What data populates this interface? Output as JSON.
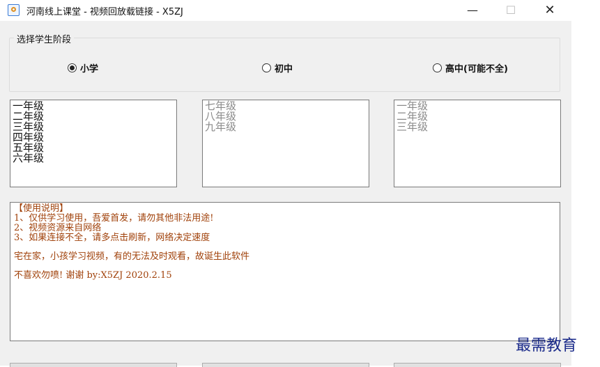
{
  "window": {
    "title": "河南线上课堂 - 视频回放载链接 - X5ZJ",
    "minimize": "—",
    "maximize": "☐",
    "close": "✕"
  },
  "stage_group": {
    "label": "选择学生阶段",
    "options": [
      {
        "label": "小学",
        "checked": true
      },
      {
        "label": "初中",
        "checked": false
      },
      {
        "label": "高中(可能不全)",
        "checked": false
      }
    ]
  },
  "grade_lists": {
    "primary": [
      "一年级",
      "二年级",
      "三年级",
      "四年级",
      "五年级",
      "六年级"
    ],
    "junior": [
      "七年级",
      "八年级",
      "九年级"
    ],
    "senior": [
      "一年级",
      "二年级",
      "三年级"
    ]
  },
  "notes": {
    "heading": "【使用说明】",
    "line1": "1、仅供学习使用，吾爱首发，请勿其他非法用途!",
    "line2": "2、视频资源来自网络",
    "line3": "3、如果连接不全，请多点击刷新，网络决定速度",
    "line4": "宅在家，小孩学习视频，有的无法及时观看，故诞生此软件",
    "line5": "不喜欢勿喷! 谢谢    by:X5ZJ 2020.2.15"
  },
  "watermark": "最需教育",
  "colors": {
    "note_text": "#a0410a",
    "watermark": "#1a2a8a",
    "window_bg": "#f0f0f0"
  }
}
